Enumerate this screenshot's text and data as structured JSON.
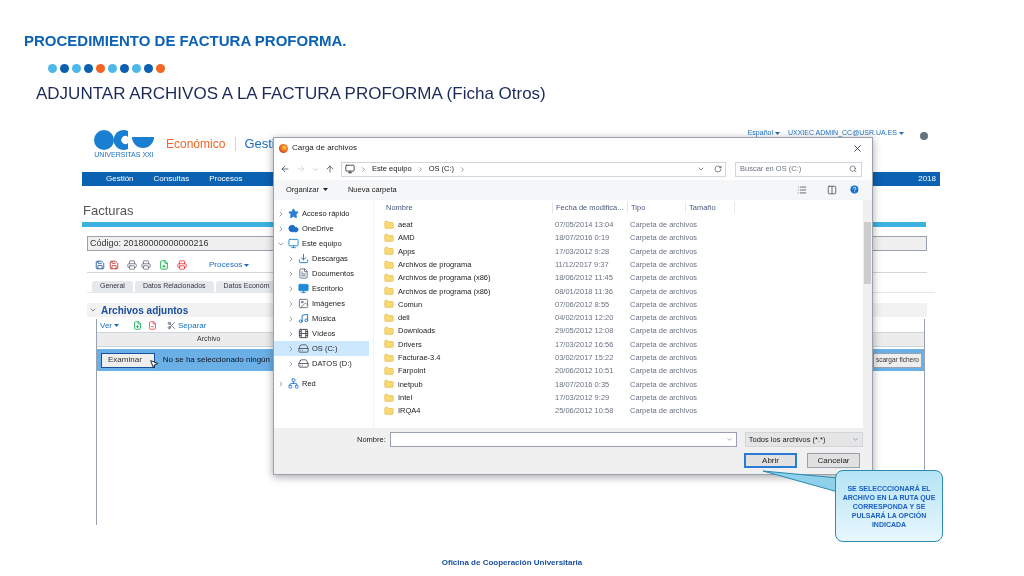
{
  "slide": {
    "title": "PROCEDIMIENTO DE FACTURA PROFORMA.",
    "dots": [
      {
        "color": "#4db8e8"
      },
      {
        "color": "#0b5fb0"
      },
      {
        "color": "#4db8e8"
      },
      {
        "color": "#0b5fb0"
      },
      {
        "color": "#f26522"
      },
      {
        "color": "#4db8e8"
      },
      {
        "color": "#0b5fb0"
      },
      {
        "color": "#4db8e8"
      },
      {
        "color": "#0b5fb0"
      },
      {
        "color": "#f26522"
      }
    ],
    "subtitle": "ADJUNTAR ARCHIVOS A LA FACTURA PROFORMA (Ficha Otros)",
    "footer": "Oficina de Cooperación Universitaria"
  },
  "app": {
    "logo_text": "UNIVERSITAS XXI",
    "module": "Económico",
    "section": "Gesti",
    "language": "Español",
    "user": "UXXIEC ADMIN_CC@USR.UA.ES",
    "nav": [
      "Gestión",
      "Consultas",
      "Procesos"
    ],
    "year": "2018",
    "page_title": "Facturas",
    "code_field": "Código: 20180000000000216",
    "toolbar_menu": "Procesos",
    "tabs": [
      "General",
      "Datos Relacionados",
      "Datos Económ"
    ],
    "section_title": "Archivos adjuntos",
    "grid_menu": "Ver",
    "grid_action": "Separar",
    "column": "Archivo",
    "browse_button": "Examinar",
    "no_file": "No se ha seleccionado ningún",
    "download_button": "scargar fichero"
  },
  "dialog": {
    "title": "Carga de archivos",
    "path": [
      "Este equipo",
      "OS (C:)"
    ],
    "search_placeholder": "Buscar en OS (C:)",
    "commands": [
      "Organizar",
      "Nueva carpeta"
    ],
    "tree": [
      {
        "label": "Acceso rápido",
        "kind": "star",
        "expanded": false,
        "selected": false
      },
      {
        "label": "OneDrive",
        "kind": "cloud",
        "expanded": false,
        "selected": false
      },
      {
        "label": "Este equipo",
        "kind": "pc",
        "expanded": true,
        "selected": false,
        "children": [
          {
            "label": "Descargas",
            "kind": "download",
            "expanded": false,
            "selected": false
          },
          {
            "label": "Documentos",
            "kind": "document",
            "expanded": false,
            "selected": false
          },
          {
            "label": "Escritorio",
            "kind": "desktop",
            "expanded": false,
            "selected": false
          },
          {
            "label": "Imágenes",
            "kind": "image",
            "expanded": false,
            "selected": false
          },
          {
            "label": "Música",
            "kind": "music",
            "expanded": false,
            "selected": false
          },
          {
            "label": "Vídeos",
            "kind": "video",
            "expanded": false,
            "selected": false
          },
          {
            "label": "OS (C:)",
            "kind": "drive",
            "expanded": false,
            "selected": true
          },
          {
            "label": "DATOS (D:)",
            "kind": "drive",
            "expanded": false,
            "selected": false
          }
        ]
      },
      {
        "label": "Red",
        "kind": "network",
        "expanded": false,
        "selected": false
      }
    ],
    "columns": [
      "Nombre",
      "Fecha de modifica...",
      "Tipo",
      "Tamaño"
    ],
    "files": [
      {
        "name": "aeat",
        "modified": "07/05/2014 13:04",
        "type": "Carpeta de archivos"
      },
      {
        "name": "AMD",
        "modified": "18/07/2016 0:19",
        "type": "Carpeta de archivos"
      },
      {
        "name": "Apps",
        "modified": "17/03/2012 9:28",
        "type": "Carpeta de archivos"
      },
      {
        "name": "Archivos de programa",
        "modified": "11/12/2017 9:37",
        "type": "Carpeta de archivos"
      },
      {
        "name": "Archivos de programa (x86)",
        "modified": "18/06/2012 11:45",
        "type": "Carpeta de archivos"
      },
      {
        "name": "Archivos de programa (x86)",
        "modified": "08/01/2018 11:36",
        "type": "Carpeta de archivos"
      },
      {
        "name": "Comun",
        "modified": "07/06/2012 8:55",
        "type": "Carpeta de archivos"
      },
      {
        "name": "dell",
        "modified": "04/02/2013 12:20",
        "type": "Carpeta de archivos"
      },
      {
        "name": "Downloads",
        "modified": "29/05/2012 12:08",
        "type": "Carpeta de archivos"
      },
      {
        "name": "Drivers",
        "modified": "17/03/2012 16:56",
        "type": "Carpeta de archivos"
      },
      {
        "name": "Facturae-3.4",
        "modified": "03/02/2017 15:22",
        "type": "Carpeta de archivos"
      },
      {
        "name": "Farpoint",
        "modified": "20/06/2012 10:51",
        "type": "Carpeta de archivos"
      },
      {
        "name": "inetpub",
        "modified": "18/07/2016 0:35",
        "type": "Carpeta de archivos"
      },
      {
        "name": "Intel",
        "modified": "17/03/2012 9:29",
        "type": "Carpeta de archivos"
      },
      {
        "name": "IRQA4",
        "modified": "25/06/2012 10:58",
        "type": "Carpeta de archivos"
      }
    ],
    "filename_label": "Nombre:",
    "filter": "Todos los archivos (*.*)",
    "buttons": [
      {
        "label": "Abrir",
        "kind": "default"
      },
      {
        "label": "Cancelar",
        "kind": "normal"
      }
    ]
  },
  "callout": {
    "text": "SE SELECCCIONARÁ EL ARCHIVO EN LA RUTA QUE CORRESPONDA Y SE PULSARÁ LA OPCIÓN INDICADA"
  }
}
